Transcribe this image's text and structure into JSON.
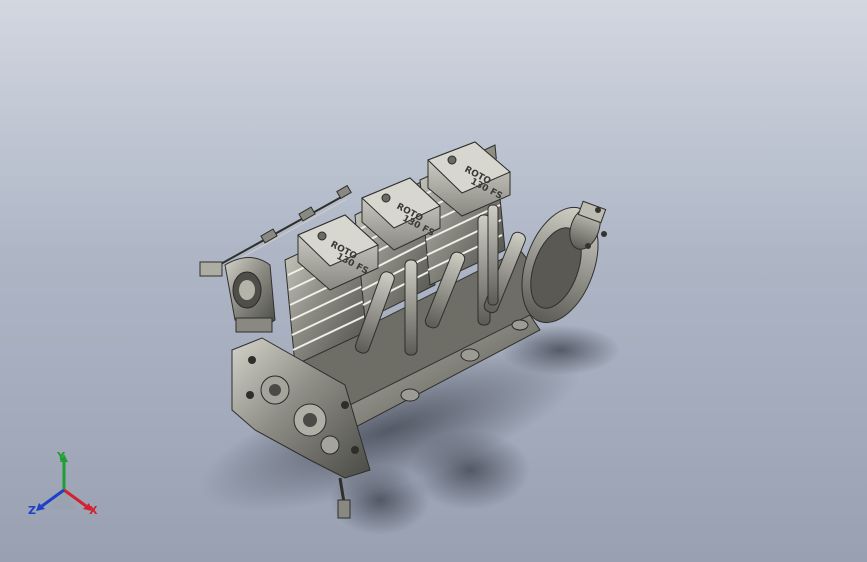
{
  "viewport": {
    "background_top": "#d2d7e0",
    "background_bottom": "#98a0b2"
  },
  "model": {
    "valve_cover_text_1": "ROTO",
    "valve_cover_text_2": "130 FS",
    "cylinder_count": 3,
    "body_color": "#7c7b73",
    "highlight_color": "#c9c8bf",
    "shadow_color": "#3b3b38"
  },
  "triad": {
    "x_label": "X",
    "y_label": "Y",
    "z_label": "Z",
    "x_color": "#d2222d",
    "y_color": "#1f9e32",
    "z_color": "#1e40c8"
  }
}
